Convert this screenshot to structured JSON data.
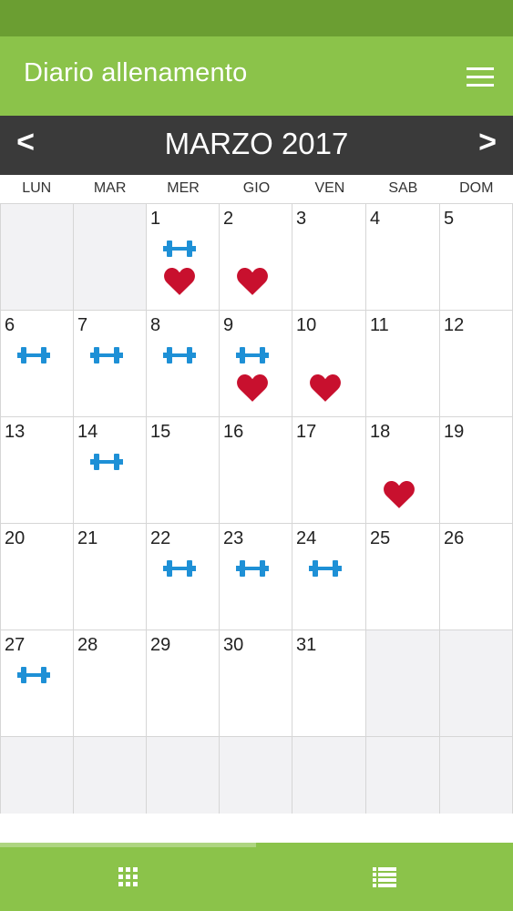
{
  "app": {
    "title": "Diario allenamento"
  },
  "calendar": {
    "month_label": "MARZO 2017",
    "prev_label": "<",
    "next_label": ">",
    "weekdays": [
      "LUN",
      "MAR",
      "MER",
      "GIO",
      "VEN",
      "SAB",
      "DOM"
    ],
    "leading_empty_days": 2,
    "days_in_month": 31,
    "total_rows": 6,
    "workout_days": [
      1,
      6,
      7,
      8,
      9,
      14,
      22,
      23,
      24,
      27
    ],
    "heart_days": [
      1,
      2,
      9,
      10,
      18
    ]
  },
  "icons": {
    "workout": "dumbbell-icon",
    "health": "heart-icon",
    "menu": "hamburger-menu-icon",
    "tab_calendar": "grid-icon",
    "tab_list": "list-icon"
  },
  "colors": {
    "primary": "#8bc34a",
    "status_bar": "#6b9e32",
    "month_bar": "#3a3a3a",
    "dumbbell": "#1e90d6",
    "heart": "#c8102e",
    "empty_cell": "#f2f2f4"
  }
}
